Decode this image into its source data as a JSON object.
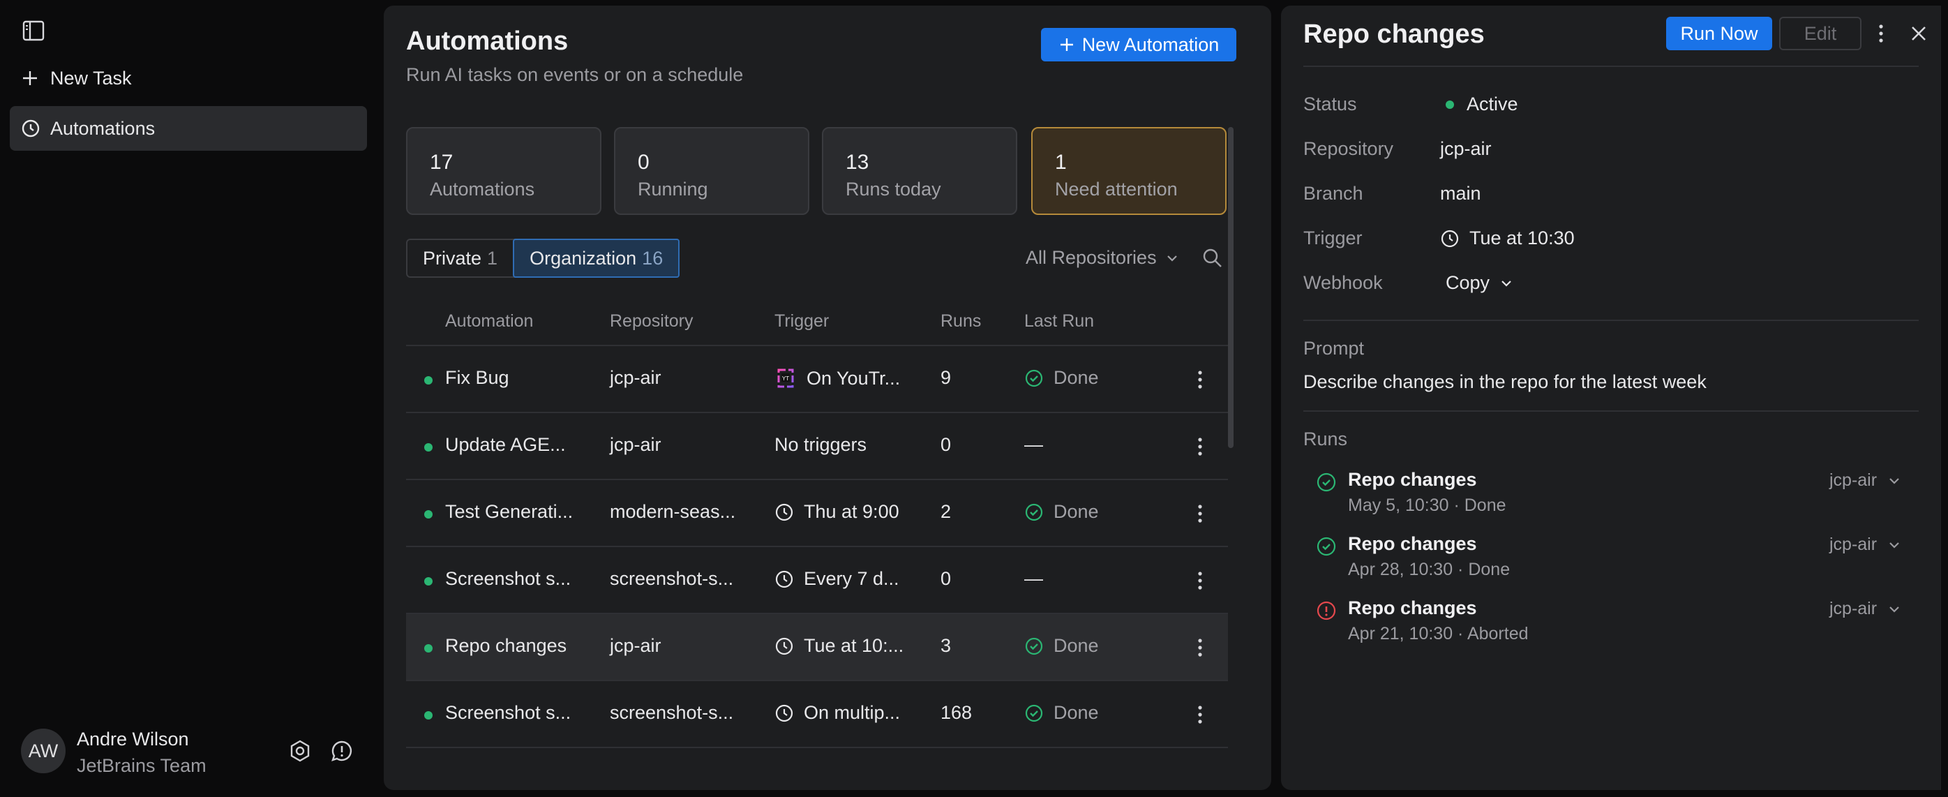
{
  "sidebar": {
    "new_task": "New Task",
    "automations": "Automations",
    "user": {
      "initials": "AW",
      "name": "Andre Wilson",
      "team": "JetBrains Team"
    }
  },
  "main": {
    "title": "Automations",
    "subtitle": "Run AI tasks on events or on a schedule",
    "new_button": "New Automation",
    "stats": [
      {
        "value": "17",
        "label": "Automations"
      },
      {
        "value": "0",
        "label": "Running"
      },
      {
        "value": "13",
        "label": "Runs today"
      },
      {
        "value": "1",
        "label": "Need attention"
      }
    ],
    "segments": {
      "private": {
        "label": "Private",
        "count": "1"
      },
      "organization": {
        "label": "Organization",
        "count": "16",
        "selected": true
      }
    },
    "repo_filter": "All Repositories",
    "columns": [
      "Automation",
      "Repository",
      "Trigger",
      "Runs",
      "Last Run"
    ],
    "rows": [
      {
        "name": "Fix Bug",
        "repo": "jcp-air",
        "trigger": "On YouTr...",
        "trigger_icon": "youtrack-icon",
        "runs": "9",
        "last": "Done",
        "last_icon": "check-circle-icon"
      },
      {
        "name": "Update AGE...",
        "repo": "jcp-air",
        "trigger": "No triggers",
        "trigger_icon": "",
        "runs": "0",
        "last": "—",
        "last_icon": ""
      },
      {
        "name": "Test Generati...",
        "repo": "modern-seas...",
        "trigger": "Thu at 9:00",
        "trigger_icon": "clock-icon",
        "runs": "2",
        "last": "Done",
        "last_icon": "check-circle-icon"
      },
      {
        "name": "Screenshot s...",
        "repo": "screenshot-s...",
        "trigger": "Every 7 d...",
        "trigger_icon": "clock-icon",
        "runs": "0",
        "last": "—",
        "last_icon": ""
      },
      {
        "name": "Repo changes",
        "repo": "jcp-air",
        "trigger": "Tue at 10:...",
        "trigger_icon": "clock-icon",
        "runs": "3",
        "last": "Done",
        "last_icon": "check-circle-icon",
        "selected": true
      },
      {
        "name": "Screenshot s...",
        "repo": "screenshot-s...",
        "trigger": "On multip...",
        "trigger_icon": "clock-icon",
        "runs": "168",
        "last": "Done",
        "last_icon": "check-circle-icon"
      }
    ]
  },
  "detail": {
    "title": "Repo changes",
    "run_now": "Run Now",
    "edit": "Edit",
    "labels": {
      "status": "Status",
      "repository": "Repository",
      "branch": "Branch",
      "trigger": "Trigger",
      "webhook": "Webhook"
    },
    "status": "Active",
    "repository": "jcp-air",
    "branch": "main",
    "trigger": "Tue at 10:30",
    "webhook": "Copy",
    "prompt_label": "Prompt",
    "prompt": "Describe changes in the repo for the latest week",
    "runs_label": "Runs",
    "runs": [
      {
        "title": "Repo changes",
        "sub": "May 5, 10:30 · Done",
        "repo": "jcp-air",
        "status": "done"
      },
      {
        "title": "Repo changes",
        "sub": "Apr 28, 10:30 · Done",
        "repo": "jcp-air",
        "status": "done"
      },
      {
        "title": "Repo changes",
        "sub": "Apr 21, 10:30 · Aborted",
        "repo": "jcp-air",
        "status": "aborted"
      }
    ]
  },
  "colors": {
    "accent": "#1a73e8",
    "success": "#2bb673",
    "warning_border": "#b58a3a",
    "error": "#e5484d"
  }
}
